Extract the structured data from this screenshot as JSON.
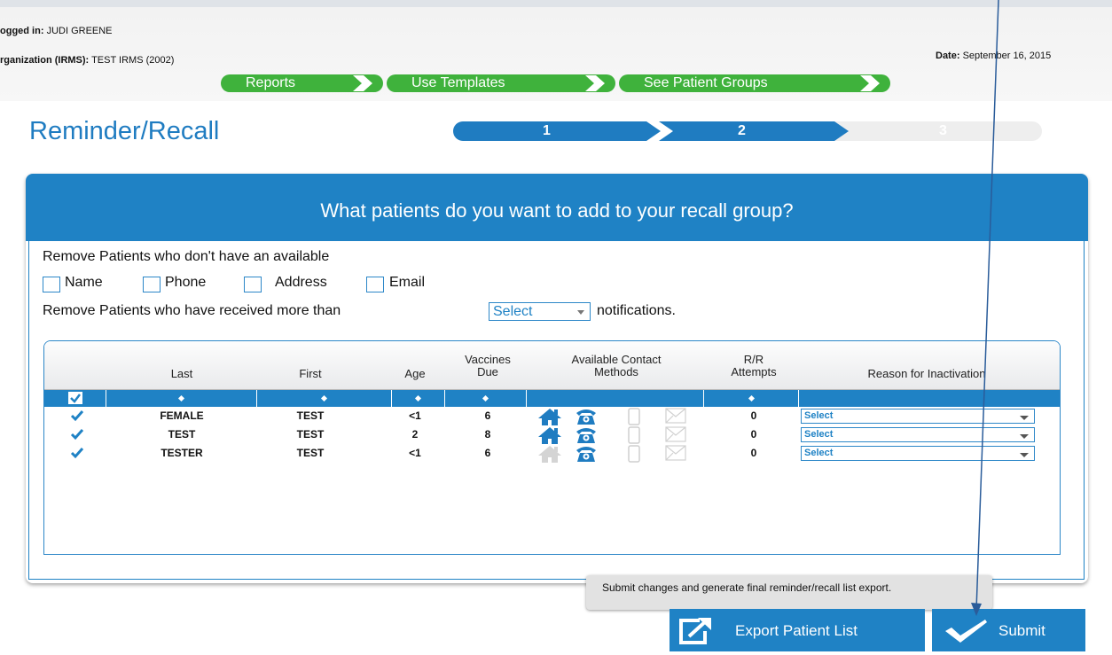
{
  "header": {
    "logged_in_label": "ogged in:",
    "logged_in_user": "JUDI GREENE",
    "org_label": "rganization (IRMS):",
    "org_value": "TEST IRMS (2002)",
    "date_label": "Date:",
    "date_value": "September 16, 2015"
  },
  "nav": {
    "reports": "Reports",
    "use_templates": "Use Templates",
    "see_patient_groups": "See Patient Groups"
  },
  "page_title": "Reminder/Recall",
  "steps": [
    "1",
    "2",
    "3"
  ],
  "panel": {
    "question": "What patients do you want to add to your recall group?",
    "remove_unavailable_text": "Remove Patients who don't have an available",
    "contact_filters": [
      "Name",
      "Phone",
      "Address",
      "Email"
    ],
    "remove_received_prefix": "Remove Patients who have received more than",
    "notif_select_value": "Select",
    "remove_received_suffix": "notifications."
  },
  "table": {
    "columns": {
      "last": "Last",
      "first": "First",
      "age": "Age",
      "vaccines_due_1": "Vaccines",
      "vaccines_due_2": "Due",
      "contact_methods_1": "Available Contact",
      "contact_methods_2": "Methods",
      "rr_attempts_1": "R/R",
      "rr_attempts_2": "Attempts",
      "reason": "Reason for Inactivation"
    },
    "rows": [
      {
        "last": "FEMALE",
        "first": "TEST",
        "age": "<1",
        "vaccines_due": "6",
        "rr_attempts": "0",
        "reason": "Select",
        "home": true,
        "phone": true,
        "mobile": false,
        "email": false
      },
      {
        "last": "TEST",
        "first": "TEST",
        "age": "2",
        "vaccines_due": "8",
        "rr_attempts": "0",
        "reason": "Select",
        "home": true,
        "phone": true,
        "mobile": false,
        "email": false
      },
      {
        "last": "TESTER",
        "first": "TEST",
        "age": "<1",
        "vaccines_due": "6",
        "rr_attempts": "0",
        "reason": "Select",
        "home": false,
        "phone": true,
        "mobile": false,
        "email": false
      }
    ]
  },
  "tooltip": "Submit changes and generate final reminder/recall list export.",
  "buttons": {
    "export": "Export Patient List",
    "submit": "Submit"
  },
  "colors": {
    "accent_blue": "#1f82c5",
    "nav_green": "#3fb23c"
  }
}
